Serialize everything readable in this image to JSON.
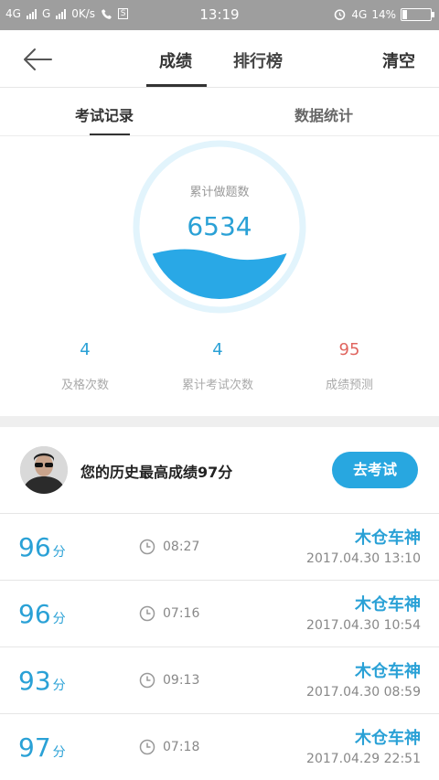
{
  "status_bar": {
    "sim1": "4G",
    "sim2": "G",
    "speed": "0K/s",
    "box_icon_text": "S",
    "time": "13:19",
    "network": "4G",
    "battery": "14%"
  },
  "header": {
    "tabs": [
      {
        "label": "成绩"
      },
      {
        "label": "排行榜"
      }
    ],
    "clear_label": "清空"
  },
  "subtabs": [
    {
      "label": "考试记录"
    },
    {
      "label": "数据统计"
    }
  ],
  "gauge": {
    "label": "累计做题数",
    "value": "6534",
    "color": "#29a8e6"
  },
  "stats": [
    {
      "value": "4",
      "label": "及格次数",
      "color": "#2aa1d6"
    },
    {
      "value": "4",
      "label": "累计考试次数",
      "color": "#2aa1d6"
    },
    {
      "value": "95",
      "label": "成绩预测",
      "color": "#e0655f"
    }
  ],
  "best": {
    "text": "您的历史最高成绩97分",
    "button_label": "去考试"
  },
  "records": [
    {
      "score": "96",
      "unit": "分",
      "duration": "08:27",
      "name": "木仓车神",
      "date": "2017.04.30  13:10"
    },
    {
      "score": "96",
      "unit": "分",
      "duration": "07:16",
      "name": "木仓车神",
      "date": "2017.04.30  10:54"
    },
    {
      "score": "93",
      "unit": "分",
      "duration": "09:13",
      "name": "木仓车神",
      "date": "2017.04.30  08:59"
    },
    {
      "score": "97",
      "unit": "分",
      "duration": "07:18",
      "name": "木仓车神",
      "date": "2017.04.29  22:51"
    }
  ],
  "colors": {
    "accent": "#2aa1d6",
    "button": "#28a7e0",
    "prediction": "#e0655f"
  }
}
